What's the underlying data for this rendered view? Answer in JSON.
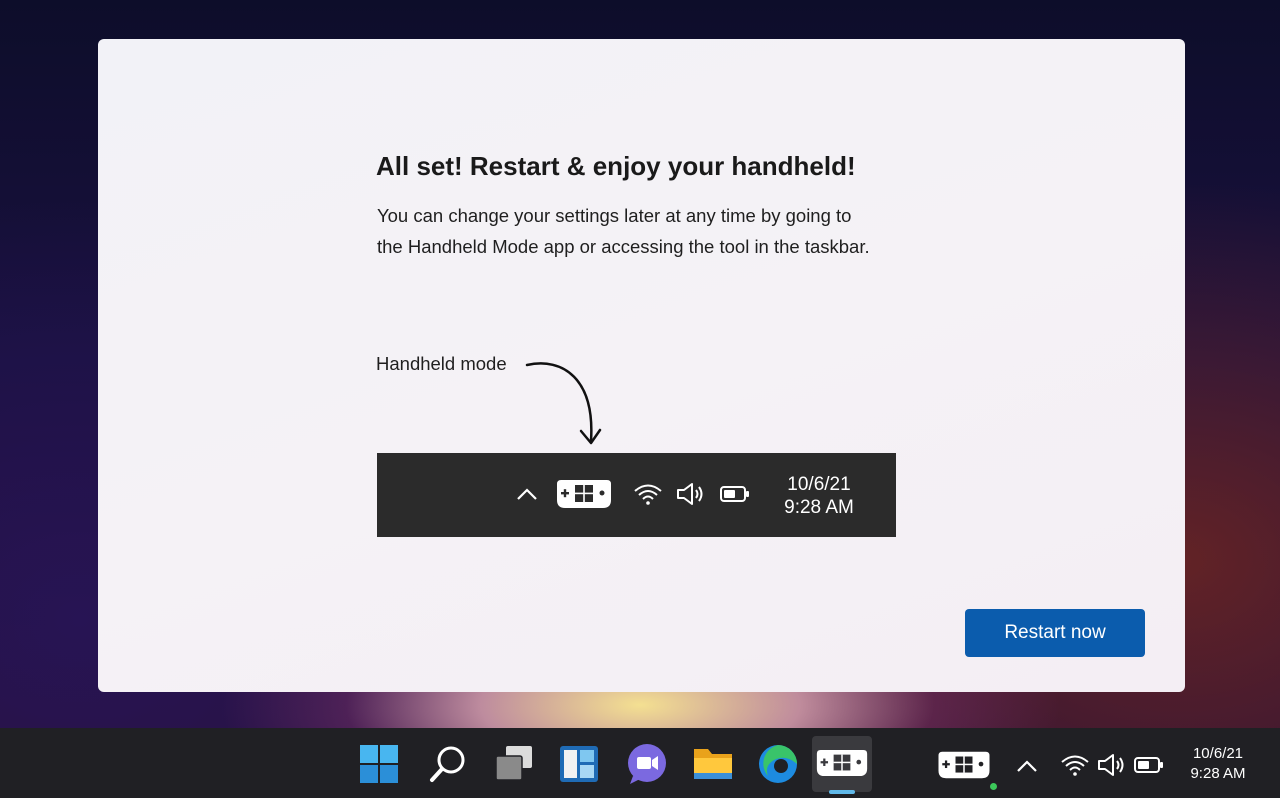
{
  "dialog": {
    "title": "All set!  Restart & enjoy your handheld!",
    "description_line1": "You can change your settings later at any time by going to",
    "description_line2": "the Handheld Mode app or accessing the tool in the taskbar.",
    "callout_label": "Handheld mode",
    "preview_taskbar": {
      "icons": [
        "chevron-up-icon",
        "handheld-mode-icon",
        "wifi-icon",
        "speaker-icon",
        "battery-icon"
      ],
      "date": "10/6/21",
      "time": "9:28 AM"
    },
    "restart_button_label": "Restart now",
    "accent_color": "#0b5cad"
  },
  "taskbar": {
    "apps": [
      "windows-start-icon",
      "search-icon",
      "task-view-icon",
      "widgets-icon",
      "chat-icon",
      "file-explorer-icon",
      "edge-browser-icon",
      "handheld-mode-app-icon"
    ],
    "tray_icons": [
      "handheld-mode-tray-icon",
      "chevron-up-icon",
      "wifi-icon",
      "speaker-icon",
      "battery-icon"
    ],
    "date": "10/6/21",
    "time": "9:28 AM"
  }
}
